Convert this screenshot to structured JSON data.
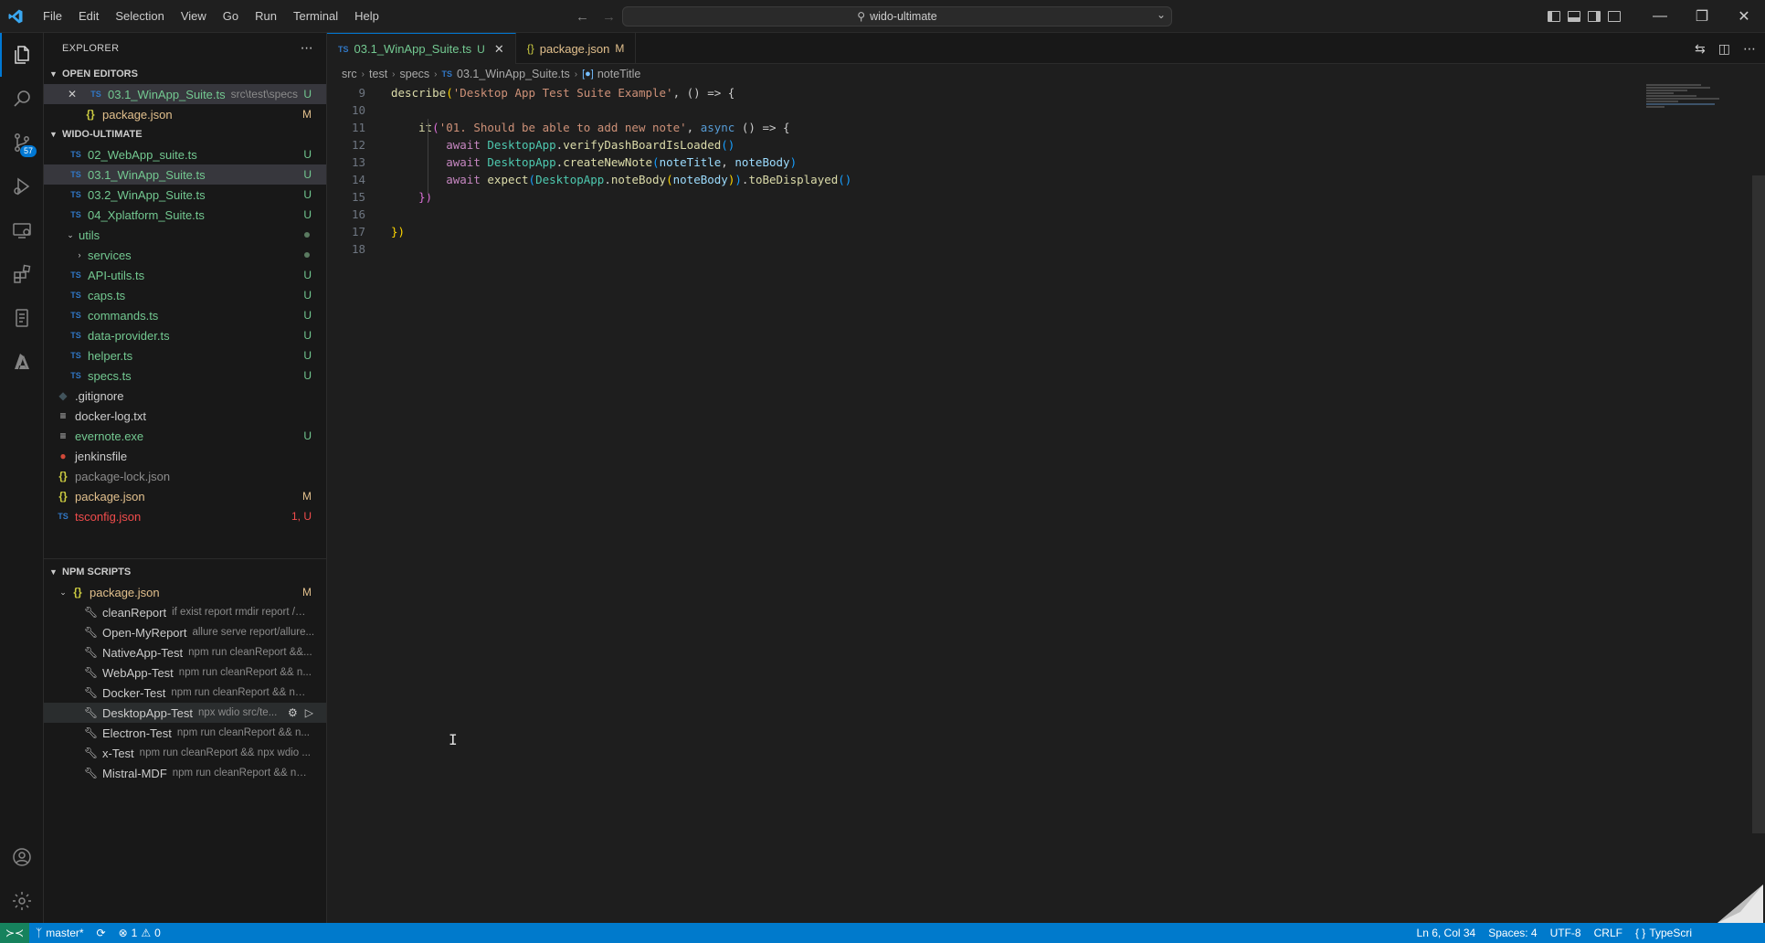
{
  "titlebar": {
    "menus": [
      "File",
      "Edit",
      "Selection",
      "View",
      "Go",
      "Run",
      "Terminal",
      "Help"
    ],
    "search_text": "wido-ultimate"
  },
  "activity": {
    "source_control_badge": "57"
  },
  "explorer": {
    "title": "EXPLORER",
    "open_editors_title": "OPEN EDITORS",
    "open_editors": [
      {
        "name": "03.1_WinApp_Suite.ts",
        "desc": "src\\test\\specs",
        "status": "U"
      },
      {
        "name": "package.json",
        "status": "M"
      }
    ],
    "workspace_title": "WIDO-ULTIMATE",
    "files": [
      {
        "name": "02_WebApp_suite.ts",
        "status": "U"
      },
      {
        "name": "03.1_WinApp_Suite.ts",
        "status": "U"
      },
      {
        "name": "03.2_WinApp_Suite.ts",
        "status": "U"
      },
      {
        "name": "04_Xplatform_Suite.ts",
        "status": "U"
      },
      {
        "name": "utils"
      },
      {
        "name": "services"
      },
      {
        "name": "API-utils.ts",
        "status": "U"
      },
      {
        "name": "caps.ts",
        "status": "U"
      },
      {
        "name": "commands.ts",
        "status": "U"
      },
      {
        "name": "data-provider.ts",
        "status": "U"
      },
      {
        "name": "helper.ts",
        "status": "U"
      },
      {
        "name": "specs.ts",
        "status": "U"
      },
      {
        "name": ".gitignore"
      },
      {
        "name": "docker-log.txt"
      },
      {
        "name": "evernote.exe",
        "status": "U"
      },
      {
        "name": "jenkinsfile"
      },
      {
        "name": "package-lock.json"
      },
      {
        "name": "package.json",
        "status": "M"
      },
      {
        "name": "tsconfig.json",
        "status": "1, U"
      }
    ]
  },
  "npm": {
    "title": "NPM SCRIPTS",
    "package": "package.json",
    "package_status": "M",
    "scripts": [
      {
        "name": "cleanReport",
        "cmd": "if exist report rmdir report /q /s"
      },
      {
        "name": "Open-MyReport",
        "cmd": "allure serve report/allure..."
      },
      {
        "name": "NativeApp-Test",
        "cmd": "npm run cleanReport &&..."
      },
      {
        "name": "WebApp-Test",
        "cmd": "npm run cleanReport && n..."
      },
      {
        "name": "Docker-Test",
        "cmd": "npm run cleanReport && np..."
      },
      {
        "name": "DesktopApp-Test",
        "cmd": "npx wdio src/te..."
      },
      {
        "name": "Electron-Test",
        "cmd": "npm run cleanReport && n..."
      },
      {
        "name": "x-Test",
        "cmd": "npm run cleanReport && npx wdio ..."
      },
      {
        "name": "Mistral-MDF",
        "cmd": "npm run cleanReport && np..."
      }
    ]
  },
  "editor": {
    "tabs": [
      {
        "label": "03.1_WinApp_Suite.ts",
        "status": "U"
      },
      {
        "label": "package.json",
        "status": "M"
      }
    ],
    "breadcrumbs": [
      "src",
      "test",
      "specs",
      "03.1_WinApp_Suite.ts",
      "noteTitle"
    ],
    "line_numbers": [
      "9",
      "10",
      "11",
      "12",
      "13",
      "14",
      "15",
      "16",
      "17",
      "18"
    ],
    "code": {
      "l9_fn": "describe",
      "l9_str": "'Desktop App Test Suite Example'",
      "l9_rest": ", () => {",
      "l11_fn": "it",
      "l11_str": "'01. Should be able to add new note'",
      "l11_async": "async",
      "l11_rest": " () => {",
      "l12_await": "await",
      "l12_cls": "DesktopApp",
      "l12_fn": "verifyDashBoardIsLoaded",
      "l13_await": "await",
      "l13_cls": "DesktopApp",
      "l13_fn": "createNewNote",
      "l13_a1": "noteTitle",
      "l13_a2": "noteBody",
      "l14_await": "await",
      "l14_fn": "expect",
      "l14_cls": "DesktopApp",
      "l14_fn2": "noteBody",
      "l14_a1": "noteBody",
      "l14_fn3": "toBeDisplayed",
      "l15": "})",
      "l17": "})"
    }
  },
  "status": {
    "branch": "master*",
    "problems": "1",
    "warnings": "0",
    "cursor": "Ln 6, Col 34",
    "spaces": "Spaces: 4",
    "encoding": "UTF-8",
    "eol": "CRLF",
    "language": "TypeScri"
  },
  "colors": {
    "accent": "#0078d4",
    "statusbar": "#007acc",
    "untracked": "#73c991",
    "modified": "#e2c08d"
  }
}
